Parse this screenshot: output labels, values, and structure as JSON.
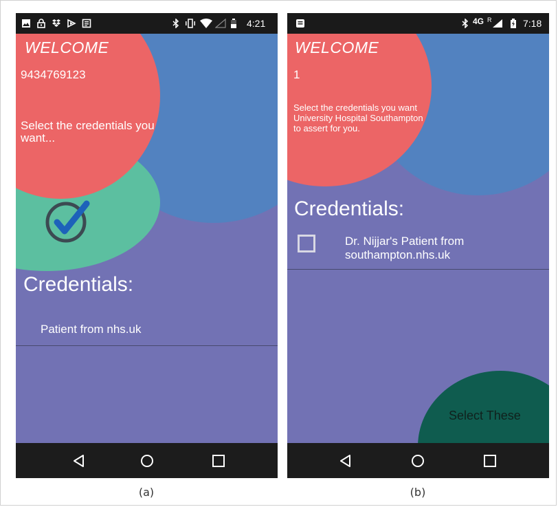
{
  "panels": [
    {
      "caption": "(a)",
      "status_bar": {
        "left_icons": [
          "image-icon",
          "lock-icon",
          "dropbox-icon",
          "cast-icon",
          "news-icon"
        ],
        "right_icons": [
          "bluetooth-icon",
          "vibrate-icon",
          "wifi-icon",
          "signal-icon",
          "battery-icon"
        ],
        "time": "4:21"
      },
      "welcome": "WELCOME",
      "user_id": "9434769123",
      "instruction": "Select the credentials you want...",
      "credentials_title": "Credentials:",
      "credentials": [
        {
          "label": "Patient from nhs.uk",
          "checked": true
        }
      ],
      "confirm_icon": "check-circle-icon",
      "nav_buttons": [
        "back-icon",
        "home-icon",
        "recents-icon"
      ]
    },
    {
      "caption": "(b)",
      "status_bar": {
        "left_icons": [
          "message-icon"
        ],
        "network": "4G",
        "roaming": "R",
        "right_icons": [
          "bluetooth-icon",
          "signal-icon",
          "battery-charging-icon"
        ],
        "time": "7:18"
      },
      "welcome": "WELCOME",
      "user_id": "1",
      "instruction": "Select the credentials you want University Hospital Southampton to assert for you.",
      "credentials_title": "Credentials:",
      "credentials": [
        {
          "label": "Dr. Nijjar's Patient from southampton.nhs.uk",
          "checked": false
        }
      ],
      "select_button": "Select These",
      "nav_buttons": [
        "back-icon",
        "home-icon",
        "recents-icon"
      ]
    }
  ],
  "colors": {
    "background": "#7272b4",
    "red_circle": "#ec6566",
    "blue_circle": "#5282c0",
    "green_circle": "#5cbfa0",
    "dark_green_button": "#0f5c4f",
    "check_blue": "#1d62ba",
    "status_bar": "#1a1a1a",
    "nav_bar": "#1c1c1c"
  }
}
